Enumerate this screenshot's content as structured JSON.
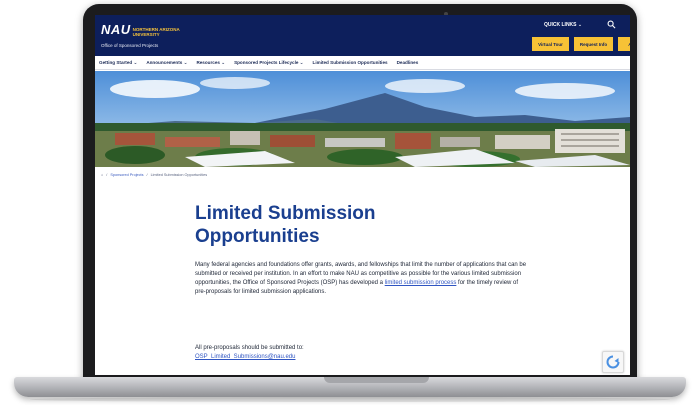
{
  "header": {
    "logo_text": "NAU",
    "logo_subtitle": "NORTHERN ARIZONA UNIVERSITY",
    "office_name": "Office of Sponsored Projects",
    "quick_links": "QUICK LINKS ⌄",
    "buttons": [
      "Virtual Tour",
      "Request Info",
      "Apply"
    ],
    "colors": {
      "navy": "#0d1f5c",
      "gold": "#f7c236"
    }
  },
  "nav": {
    "items": [
      "Getting Started ⌄",
      "Announcements ⌄",
      "Resources ⌄",
      "Sponsored Projects Lifecycle ⌄",
      "Limited Submission Opportunities",
      "Deadlines"
    ]
  },
  "breadcrumb": {
    "home": "⌂",
    "sep": "/",
    "parent": "Sponsored Projects",
    "current": "Limited Submission Opportunities"
  },
  "content": {
    "title": "Limited Submission Opportunities",
    "paragraph_before_link": "Many federal agencies and foundations offer grants, awards, and fellowships that limit the number of applications that can be submitted or received per institution. In an effort to make NAU as competitive as possible for the various limited submission opportunities, the Office of Sponsored Projects (OSP) has developed a ",
    "paragraph_link": "limited submission process",
    "paragraph_after_link": " for the timely review of pre-proposals for limited submission applications.",
    "pre_proposals_text": "All pre-proposals should be submitted to:",
    "email": "OSP_Limited_Submissions@nau.edu"
  },
  "icons": {
    "search": "search-icon",
    "recaptcha": "recaptcha-icon"
  }
}
